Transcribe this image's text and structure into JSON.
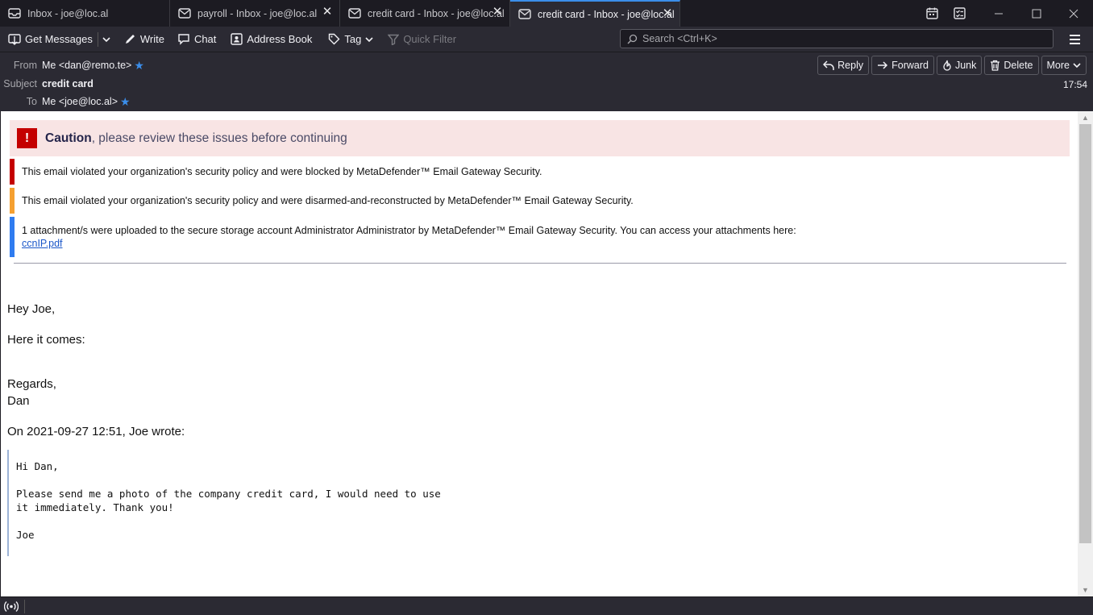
{
  "tabs": [
    {
      "label": "Inbox - joe@loc.al",
      "closable": false
    },
    {
      "label": "payroll - Inbox - joe@loc.al",
      "closable": true
    },
    {
      "label": "credit card - Inbox - joe@loc.al",
      "closable": true
    },
    {
      "label": "credit card - Inbox - joe@loc.al",
      "closable": true,
      "active": true
    }
  ],
  "toolbar": {
    "get_messages": "Get Messages",
    "write": "Write",
    "chat": "Chat",
    "address_book": "Address Book",
    "tag": "Tag",
    "quick_filter": "Quick Filter",
    "search_placeholder": "Search <Ctrl+K>"
  },
  "header": {
    "from_label": "From",
    "from_value": "Me <dan@remo.te>",
    "subject_label": "Subject",
    "subject_value": "credit card",
    "to_label": "To",
    "to_value": "Me <joe@loc.al>",
    "time": "17:54",
    "actions": {
      "reply": "Reply",
      "forward": "Forward",
      "junk": "Junk",
      "delete": "Delete",
      "more": "More"
    }
  },
  "banner": {
    "caution_strong": "Caution",
    "caution_rest": ", please review these issues before continuing",
    "notices": [
      {
        "text": "This email violated your organization's security policy and were blocked by MetaDefender™ Email Gateway Security.",
        "color": "#c40000"
      },
      {
        "text": "This email violated your organization's security policy and were disarmed-and-reconstructed by MetaDefender™ Email Gateway Security.",
        "color": "#f5a031"
      },
      {
        "text": "1 attachment/s were uploaded to the secure storage account Administrator Administrator by MetaDefender™ Email Gateway Security. You can access your attachments here:",
        "color": "#2f7cf0",
        "link": "ccnIP.pdf"
      }
    ]
  },
  "message": {
    "greeting": "Hey Joe,",
    "line1": "Here it comes:",
    "regards": "Regards,",
    "signature": "Dan",
    "attribution": "On 2021-09-27 12:51, Joe wrote:",
    "quote": {
      "greeting": "Hi Dan,",
      "line1": "Please send me a photo of the company credit card, I would need to use",
      "line2": "it immediately. Thank you!",
      "signature": "Joe"
    }
  },
  "colors": {
    "accent": "#3b8eea",
    "caution_bg": "#f8e4e4",
    "caution_icon": "#c40000"
  }
}
